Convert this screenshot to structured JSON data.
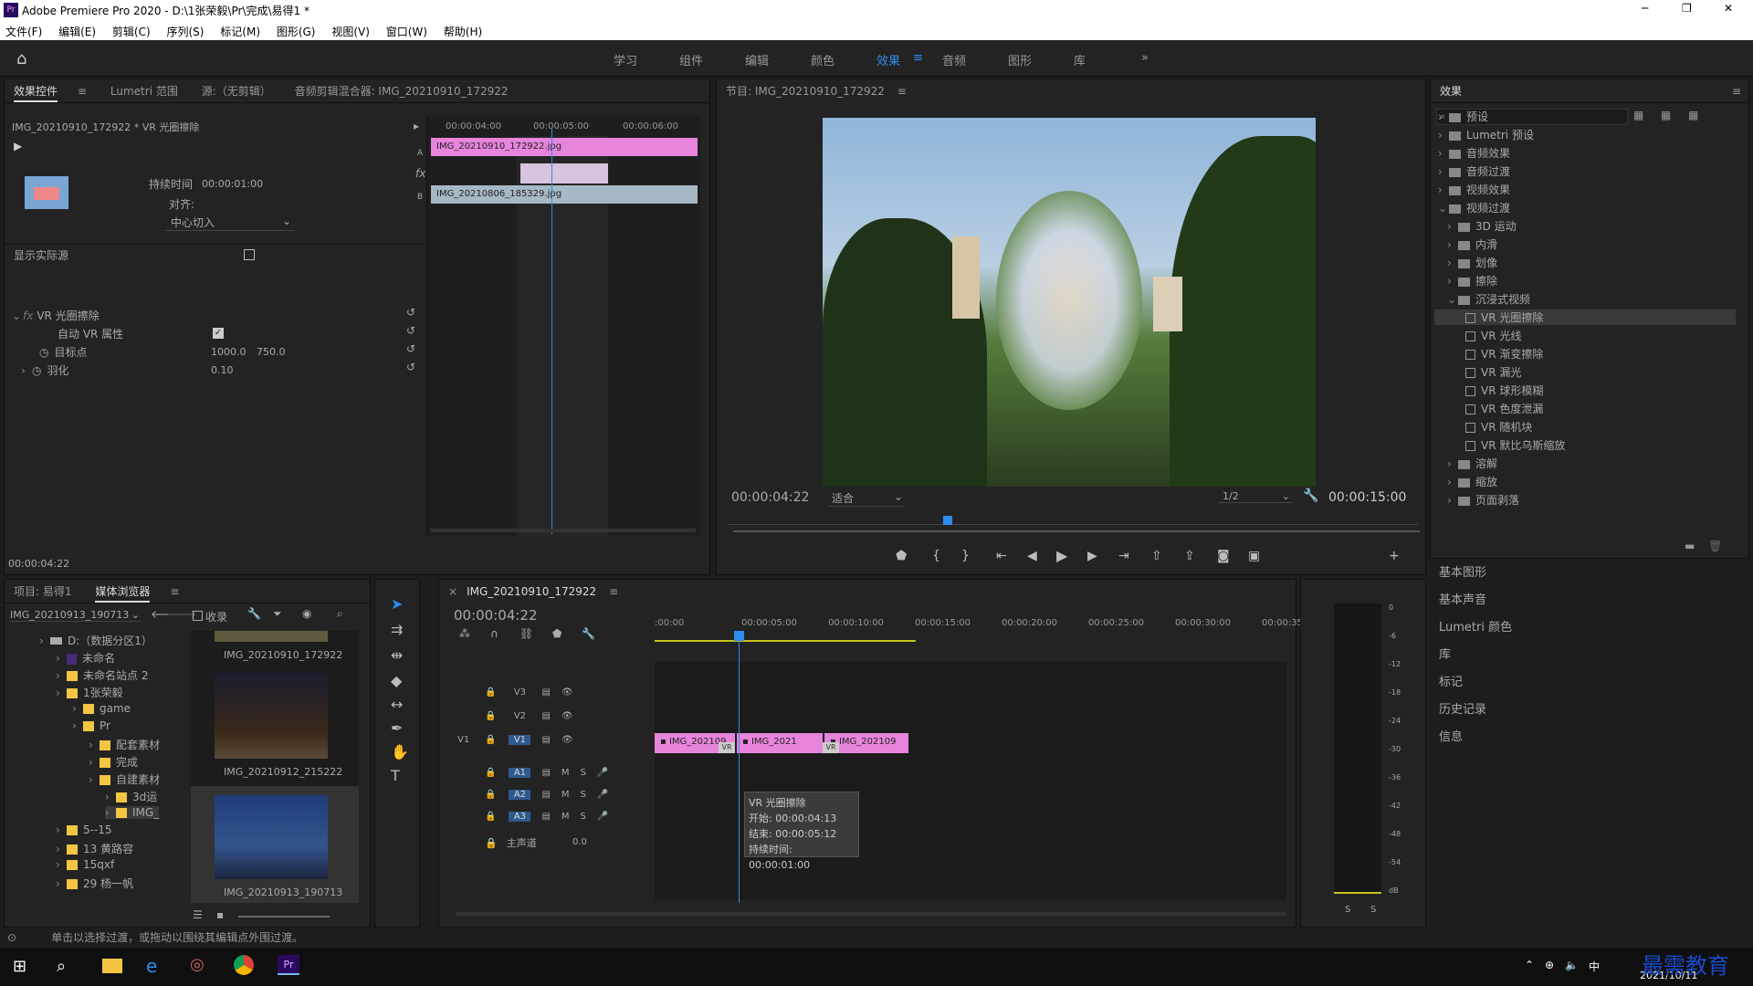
{
  "window": {
    "title": "Adobe Premiere Pro 2020 - D:\\1张荣毅\\Pr\\完成\\易得1 *",
    "controls": [
      "─",
      "❐",
      "✕"
    ]
  },
  "menu": [
    "文件(F)",
    "编辑(E)",
    "剪辑(C)",
    "序列(S)",
    "标记(M)",
    "图形(G)",
    "视图(V)",
    "窗口(W)",
    "帮助(H)"
  ],
  "workspaces": [
    "学习",
    "组件",
    "编辑",
    "颜色",
    "效果",
    "音频",
    "图形",
    "库"
  ],
  "workspace_active": "效果",
  "workspace_more": "»",
  "effect_controls": {
    "tabs": [
      "效果控件",
      "Lumetri 范围",
      "源:（无剪辑）",
      "音频剪辑混合器: IMG_20210910_172922"
    ],
    "clip_path": "IMG_20210910_172922 * VR 光圈擦除",
    "duration_label": "持续时间",
    "duration": "00:00:01:00",
    "align_label": "对齐:",
    "align_value": "中心切入",
    "show_source": "显示实际源",
    "effect_name": "VR 光圈擦除",
    "auto_vr": "自动 VR 属性",
    "target_label": "目标点",
    "target_x": "1000.0",
    "target_y": "750.0",
    "feather_label": "羽化",
    "feather_value": "0.10",
    "mini_ticks": [
      "00:00:04:00",
      "00:00:05:00",
      "00:00:06:00"
    ],
    "clip_a": "IMG_20210910_172922.jpg",
    "clip_b": "IMG_20210806_185329.jpg",
    "label_a": "A",
    "label_b": "B",
    "fx_label": "fx",
    "timecode": "00:00:04:22"
  },
  "program": {
    "title": "节目: IMG_20210910_172922",
    "timecode": "00:00:04:22",
    "fit": "适合",
    "resolution": "1/2",
    "duration": "00:00:15:00"
  },
  "effects_panel": {
    "title": "效果",
    "top_items": [
      "预设",
      "Lumetri 预设",
      "音频效果",
      "音频过渡",
      "视频效果",
      "视频过渡"
    ],
    "sub_items": [
      "3D 运动",
      "内滑",
      "划像",
      "擦除",
      "沉浸式视频"
    ],
    "vr_items": [
      "VR 光圈擦除",
      "VR 光线",
      "VR 渐变擦除",
      "VR 漏光",
      "VR 球形模糊",
      "VR 色度泄漏",
      "VR 随机块",
      "VR 默比乌斯缩放"
    ],
    "after_items": [
      "溶解",
      "缩放",
      "页面剥落"
    ],
    "collapsed": [
      "基本图形",
      "基本声音",
      "Lumetri 颜色",
      "库",
      "标记",
      "历史记录",
      "信息"
    ]
  },
  "project": {
    "tabs": [
      "项目: 易得1",
      "媒体浏览器"
    ],
    "path": "IMG_20210913_190713",
    "favorites": "收录",
    "tree": [
      {
        "label": "D:（数据分区1）",
        "indent": 0,
        "type": "drive"
      },
      {
        "label": "未命名",
        "indent": 1,
        "type": "pr"
      },
      {
        "label": "未命名站点 2",
        "indent": 1,
        "type": "folder"
      },
      {
        "label": "1张荣毅",
        "indent": 1,
        "type": "folder"
      },
      {
        "label": "game",
        "indent": 2,
        "type": "folder"
      },
      {
        "label": "Pr",
        "indent": 2,
        "type": "folder"
      },
      {
        "label": "配套素材",
        "indent": 3,
        "type": "folder"
      },
      {
        "label": "完成",
        "indent": 3,
        "type": "folder"
      },
      {
        "label": "自建素材",
        "indent": 3,
        "type": "folder"
      },
      {
        "label": "3d运",
        "indent": 4,
        "type": "folder"
      },
      {
        "label": "IMG_",
        "indent": 4,
        "type": "folder"
      },
      {
        "label": "5--15",
        "indent": 1,
        "type": "folder"
      },
      {
        "label": "13 黄路容",
        "indent": 1,
        "type": "folder"
      },
      {
        "label": "15qxf",
        "indent": 1,
        "type": "folder"
      },
      {
        "label": "29 杨一帆",
        "indent": 1,
        "type": "folder"
      }
    ],
    "thumbs": [
      "IMG_20210910_172922",
      "IMG_20210912_215222",
      "IMG_20210913_190713"
    ]
  },
  "timeline": {
    "tab": "IMG_20210910_172922",
    "timecode": "00:00:04:22",
    "ticks": [
      ":00:00",
      "00:00:05:00",
      "00:00:10:00",
      "00:00:15:00",
      "00:00:20:00",
      "00:00:25:00",
      "00:00:30:00",
      "00:00:35:00"
    ],
    "video_tracks": [
      "V3",
      "V2",
      "V1"
    ],
    "audio_tracks": [
      "A1",
      "A2",
      "A3"
    ],
    "master": "主声道",
    "master_value": "0.0",
    "source_v1": "V1",
    "clips": [
      "IMG_202109",
      "IMG_2021",
      "IMG_202109"
    ],
    "vr_badge": "VR",
    "tooltip": {
      "title": "VR 光圈擦除",
      "start": "开始: 00:00:04:13",
      "end": "结束: 00:00:05:12",
      "dur": "持续时间: 00:00:01:00"
    }
  },
  "meter": {
    "labels": [
      "0",
      "-6",
      "-12",
      "-18",
      "-24",
      "-30",
      "-36",
      "-42",
      "-48",
      "-54",
      "dB"
    ],
    "solo": [
      "S",
      "S"
    ]
  },
  "status": "单击以选择过渡，或拖动以围绕其编辑点外围过渡。",
  "taskbar": {
    "time": "2021/10/11",
    "ime": "中",
    "watermark": "最需教育"
  }
}
